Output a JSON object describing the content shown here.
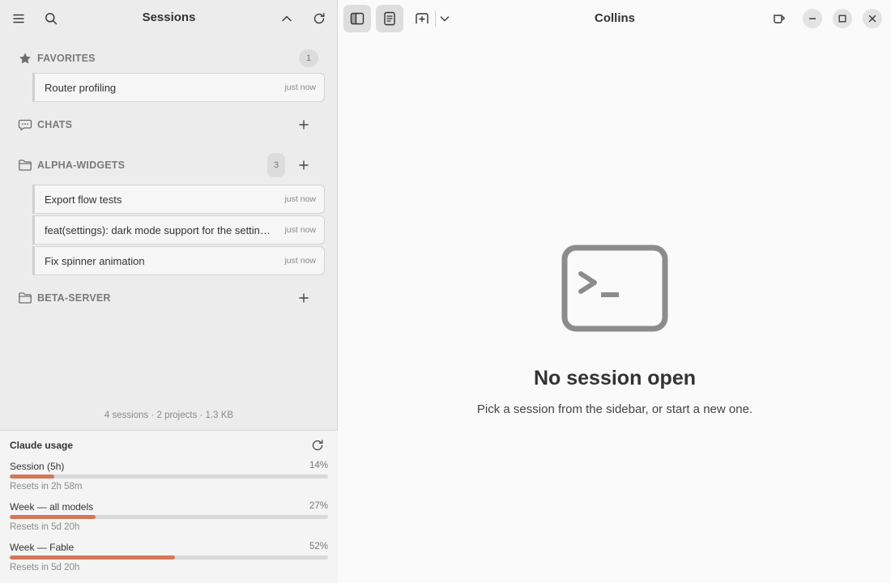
{
  "sidebar": {
    "title": "Sessions",
    "favorites": {
      "label": "FAVORITES",
      "count": "1",
      "items": [
        {
          "title": "Router profiling",
          "time": "just now"
        }
      ]
    },
    "chats": {
      "label": "CHATS"
    },
    "projects": [
      {
        "label": "ALPHA-WIDGETS",
        "count": "3",
        "items": [
          {
            "title": "Export flow tests",
            "time": "just now"
          },
          {
            "title": "feat(settings): dark mode support for the settings panel",
            "time": "just now"
          },
          {
            "title": "Fix spinner animation",
            "time": "just now"
          }
        ]
      },
      {
        "label": "BETA-SERVER"
      }
    ],
    "stats": "4 sessions · 2 projects · 1.3 KB"
  },
  "usage": {
    "title": "Claude usage",
    "meters": [
      {
        "label": "Session (5h)",
        "percent_text": "14%",
        "percent": 14,
        "reset": "Resets in 2h 58m"
      },
      {
        "label": "Week — all models",
        "percent_text": "27%",
        "percent": 27,
        "reset": "Resets in 5d 20h"
      },
      {
        "label": "Week — Fable",
        "percent_text": "52%",
        "percent": 52,
        "reset": "Resets in 5d 20h"
      }
    ],
    "accent_color": "#d4785a"
  },
  "main": {
    "title": "Collins",
    "empty_title": "No session open",
    "empty_subtitle": "Pick a session from the sidebar, or start a new one."
  },
  "icons": {
    "menu": "hamburger-icon",
    "search": "search-icon",
    "collapse": "chevron-up-icon",
    "refresh": "refresh-icon",
    "star": "star-icon",
    "chat": "chat-bubble-icon",
    "folder": "folder-icon",
    "add": "plus-icon",
    "sidebar_toggle": "sidebar-toggle-icon",
    "notes": "notes-icon",
    "new_tab": "new-tab-icon",
    "dropdown": "chevron-down-icon",
    "mug": "mug-icon",
    "minimize": "minimize-icon",
    "maximize": "maximize-icon",
    "close": "close-icon",
    "terminal": "terminal-icon"
  }
}
